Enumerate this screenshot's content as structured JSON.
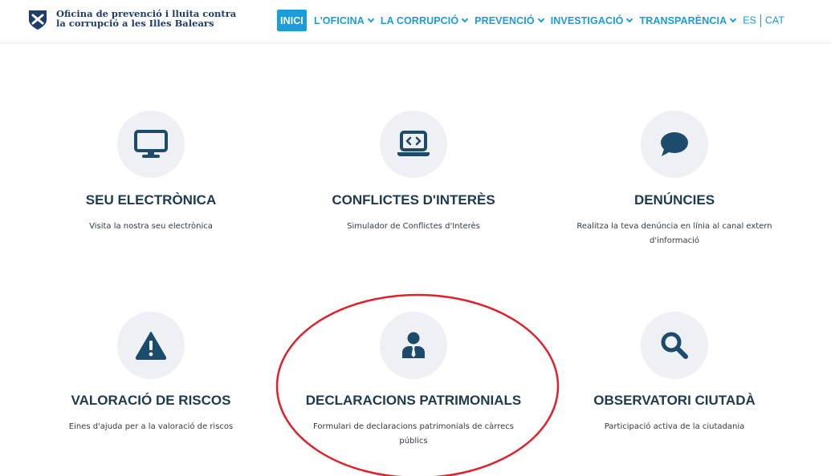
{
  "header": {
    "logo": {
      "line1": "Oficina de prevenció i lluita contra",
      "line2": "la corrupció a les Illes Balears"
    },
    "nav": [
      {
        "label": "INICI",
        "active": true,
        "dropdown": false
      },
      {
        "label": "L'OFICINA",
        "active": false,
        "dropdown": true
      },
      {
        "label": "LA CORRUPCIÓ",
        "active": false,
        "dropdown": true
      },
      {
        "label": "PREVENCIÓ",
        "active": false,
        "dropdown": true
      },
      {
        "label": "INVESTIGACIÓ",
        "active": false,
        "dropdown": true
      },
      {
        "label": "TRANSPARÈNCIA",
        "active": false,
        "dropdown": true
      }
    ],
    "lang": {
      "es": "ES",
      "cat": "CAT"
    }
  },
  "cards": [
    {
      "icon": "monitor-icon",
      "title": "SEU ELECTRÒNICA",
      "desc": "Visita la nostra seu electrònica"
    },
    {
      "icon": "laptop-code-icon",
      "title": "CONFLICTES D'INTERÈS",
      "desc": "Simulador de Conflictes d'Interès"
    },
    {
      "icon": "speech-bubble-icon",
      "title": "DENÚNCIES",
      "desc": "Realitza la teva denúncia en línia al canal extern d'informació"
    },
    {
      "icon": "warning-triangle-icon",
      "title": "VALORACIÓ DE RISCOS",
      "desc": "Eines d'ajuda per a la valoració de riscos"
    },
    {
      "icon": "user-tie-icon",
      "title": "DECLARACIONS PATRIMONIALS",
      "desc": "Formulari de declaracions patrimonials de càrrecs públics"
    },
    {
      "icon": "magnifier-icon",
      "title": "OBSERVATORI CIUTADÀ",
      "desc": "Participació activa de la ciutadania"
    }
  ],
  "colors": {
    "accent": "#1a9dd8",
    "title": "#1d3a4f",
    "icon": "#1d4b6b",
    "circle": "#eef0f3",
    "annotation": "#e0202a"
  }
}
